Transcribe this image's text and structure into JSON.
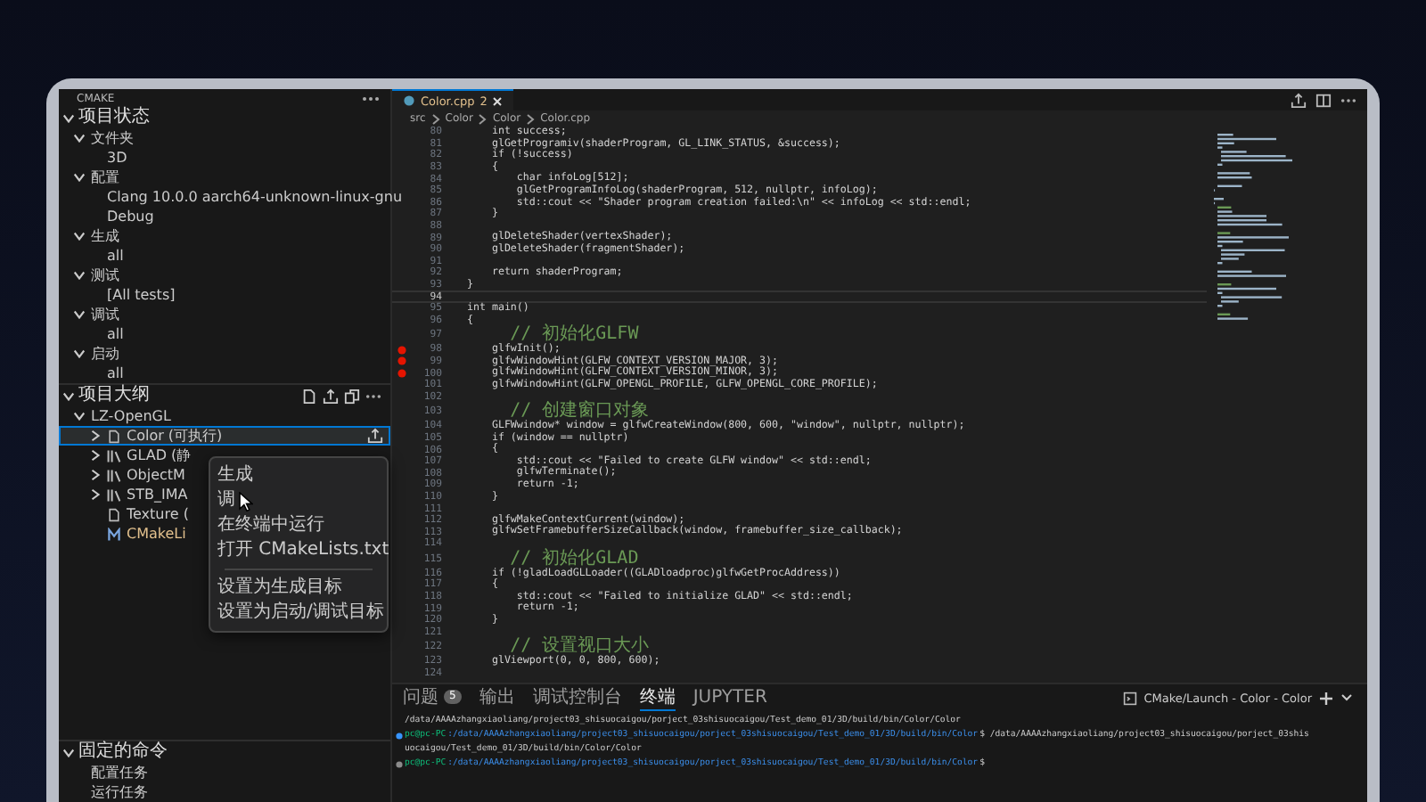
{
  "sidebar": {
    "title": "CMAKE",
    "status_section": {
      "title": "项目状态",
      "expanded": true,
      "tree": [
        {
          "label": "文件夹",
          "expanded": true,
          "children": [
            {
              "label": "3D"
            }
          ]
        },
        {
          "label": "配置",
          "expanded": true,
          "children": [
            {
              "label": "Clang 10.0.0 aarch64-unknown-linux-gnu"
            },
            {
              "label": "Debug"
            }
          ]
        },
        {
          "label": "生成",
          "expanded": true,
          "children": [
            {
              "label": "all"
            }
          ]
        },
        {
          "label": "测试",
          "expanded": true,
          "children": [
            {
              "label": "[All tests]"
            }
          ]
        },
        {
          "label": "调试",
          "expanded": true,
          "children": [
            {
              "label": "all"
            }
          ]
        },
        {
          "label": "启动",
          "expanded": true,
          "children": [
            {
              "label": "all"
            }
          ]
        }
      ]
    },
    "outline_section": {
      "title": "项目大纲",
      "expanded": true,
      "tree": [
        {
          "label": "LZ-OpenGL",
          "expanded": true,
          "children": [
            {
              "label": "Color (可执行)",
              "kind": "executable",
              "expanded": false,
              "selected": true
            },
            {
              "label": "GLAD (静",
              "kind": "library",
              "expanded": false,
              "selected": false
            },
            {
              "label": "ObjectM",
              "kind": "library",
              "expanded": false,
              "selected": false
            },
            {
              "label": "STB_IMA",
              "kind": "library",
              "expanded": false,
              "selected": false
            },
            {
              "label": "Texture (",
              "kind": "executable",
              "selected": false
            },
            {
              "label": "CMakeLi",
              "kind": "cmake",
              "selected": false
            }
          ]
        }
      ]
    },
    "pinned_section": {
      "title": "固定的命令",
      "expanded": true,
      "tree": [
        {
          "label": "配置任务"
        },
        {
          "label": "运行任务"
        }
      ]
    }
  },
  "context_menu": {
    "groups": [
      [
        "生成",
        "调",
        "在终端中运行",
        "打开 CMakeLists.txt"
      ],
      [
        "设置为生成目标",
        "设置为启动/调试目标"
      ]
    ]
  },
  "editor": {
    "tab": {
      "label": "Color.cpp",
      "problems": "2"
    },
    "breadcrumb": [
      "src",
      "Color",
      "Color",
      "Color.cpp"
    ],
    "lines": [
      {
        "num": "80",
        "text": "    int success;"
      },
      {
        "num": "81",
        "text": "    glGetProgramiv(shaderProgram, GL_LINK_STATUS, &success);"
      },
      {
        "num": "82",
        "text": "    if (!success)"
      },
      {
        "num": "83",
        "text": "    {"
      },
      {
        "num": "84",
        "text": "        char infoLog[512];"
      },
      {
        "num": "85",
        "text": "        glGetProgramInfoLog(shaderProgram, 512, nullptr, infoLog);"
      },
      {
        "num": "86",
        "text": "        std::cout << \"Shader program creation failed:\\n\" << infoLog << std::endl;"
      },
      {
        "num": "87",
        "text": "    }"
      },
      {
        "num": "88"
      },
      {
        "num": "89",
        "text": "    glDeleteShader(vertexShader);"
      },
      {
        "num": "90",
        "text": "    glDeleteShader(fragmentShader);"
      },
      {
        "num": "91"
      },
      {
        "num": "92",
        "text": "    return shaderProgram;"
      },
      {
        "num": "93",
        "text": "}"
      },
      {
        "num": "94",
        "current": true
      },
      {
        "num": "95",
        "text": "int main()"
      },
      {
        "num": "96",
        "text": "{"
      },
      {
        "num": "97",
        "text": "    // 初始化GLFW",
        "kind": "comment"
      },
      {
        "num": "98",
        "text": "    glfwInit();",
        "breakpoint": true
      },
      {
        "num": "99",
        "text": "    glfwWindowHint(GLFW_CONTEXT_VERSION_MAJOR, 3);",
        "breakpoint": true
      },
      {
        "num": "100",
        "text": "    glfwWindowHint(GLFW_CONTEXT_VERSION_MINOR, 3);",
        "breakpoint": true
      },
      {
        "num": "101",
        "text": "    glfwWindowHint(GLFW_OPENGL_PROFILE, GLFW_OPENGL_CORE_PROFILE);"
      },
      {
        "num": "102"
      },
      {
        "num": "103",
        "text": "    // 创建窗口对象",
        "kind": "comment"
      },
      {
        "num": "104",
        "text": "    GLFWwindow* window = glfwCreateWindow(800, 600, \"window\", nullptr, nullptr);"
      },
      {
        "num": "105",
        "text": "    if (window == nullptr)"
      },
      {
        "num": "106",
        "text": "    {"
      },
      {
        "num": "107",
        "text": "        std::cout << \"Failed to create GLFW window\" << std::endl;"
      },
      {
        "num": "108",
        "text": "        glfwTerminate();"
      },
      {
        "num": "109",
        "text": "        return -1;"
      },
      {
        "num": "110",
        "text": "    }"
      },
      {
        "num": "111"
      },
      {
        "num": "112",
        "text": "    glfwMakeContextCurrent(window);"
      },
      {
        "num": "113",
        "text": "    glfwSetFramebufferSizeCallback(window, framebuffer_size_callback);"
      },
      {
        "num": "114"
      },
      {
        "num": "115",
        "text": "    // 初始化GLAD",
        "kind": "comment"
      },
      {
        "num": "116",
        "text": "    if (!gladLoadGLLoader((GLADloadproc)glfwGetProcAddress))"
      },
      {
        "num": "117",
        "text": "    {"
      },
      {
        "num": "118",
        "text": "        std::cout << \"Failed to initialize GLAD\" << std::endl;"
      },
      {
        "num": "119",
        "text": "        return -1;"
      },
      {
        "num": "120",
        "text": "    }"
      },
      {
        "num": "121"
      },
      {
        "num": "122",
        "text": "    // 设置视口大小",
        "kind": "comment"
      },
      {
        "num": "123",
        "text": "    glViewport(0, 0, 800, 600);"
      },
      {
        "num": "124"
      }
    ]
  },
  "terminal": {
    "tabs": [
      {
        "label": "问题",
        "badge": "5",
        "selected": false
      },
      {
        "label": "输出",
        "selected": false
      },
      {
        "label": "调试控制台",
        "selected": false
      },
      {
        "label": "终端",
        "selected": true
      },
      {
        "label": "JUPYTER",
        "selected": false
      }
    ],
    "session": "CMake/Launch - Color - Color",
    "lines": [
      {
        "command": "/data/AAAAzhangxiaoliang/project03_shisuocaigou/porject_03shisuocaigou/Test_demo_01/3D/build/bin/Color/Color"
      },
      {
        "color": "#3794ff",
        "prompt": "pc@pc-PC",
        "path": ":/data/AAAAzhangxiaoliang/project03_shisuocaigou/porject_03shisuocaigou/Test_demo_01/3D/build/bin/Color",
        "command": "$ /data/AAAAzhangxiaoliang/project03_shisuocaigou/porject_03shis"
      },
      {
        "command": "uocaigou/Test_demo_01/3D/build/bin/Color/Color"
      },
      {
        "color": "#8b8b8b",
        "prompt": "pc@pc-PC",
        "path": ":/data/AAAAzhangxiaoliang/project03_shisuocaigou/porject_03shisuocaigou/Test_demo_01/3D/build/bin/Color",
        "command": "$"
      }
    ]
  }
}
